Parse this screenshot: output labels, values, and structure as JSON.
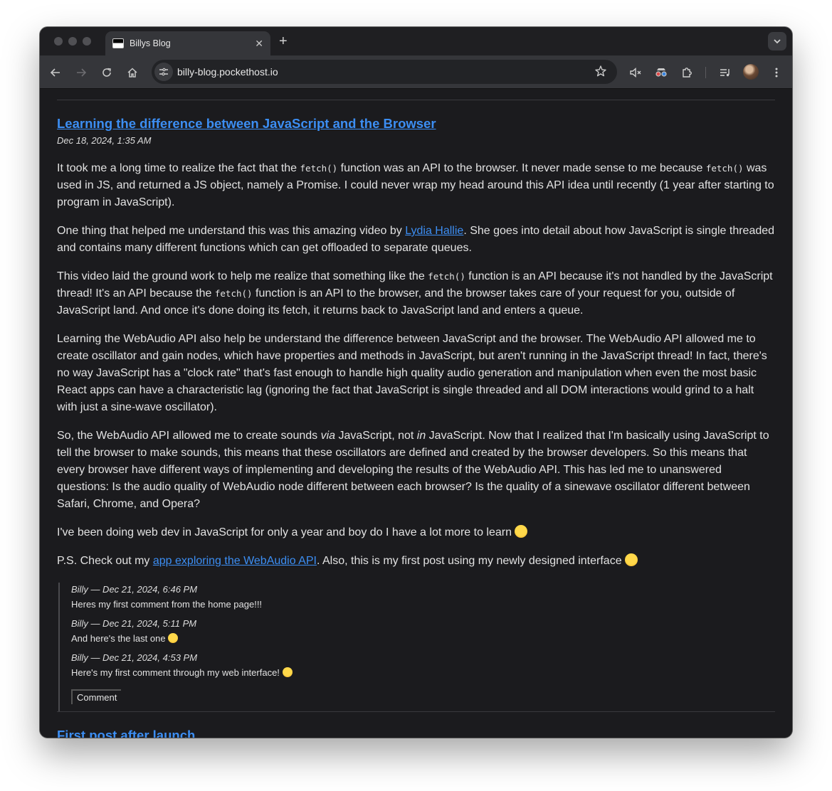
{
  "browser": {
    "tab_title": "Billys Blog",
    "url": "billy-blog.pockethost.io"
  },
  "post": {
    "title": "Learning the difference between JavaScript and the Browser",
    "date": "Dec 18, 2024, 1:35 AM",
    "p1": {
      "a": "It took me a long time to realize the fact that the ",
      "code1": "fetch()",
      "b": " function was an API to the browser. It never made sense to me because ",
      "code2": "fetch()",
      "c": " was used in JS, and returned a JS object, namely a Promise. I could never wrap my head around this API idea until recently (1 year after starting to program in JavaScript)."
    },
    "p2": {
      "a": "One thing that helped me understand this was this amazing video by ",
      "link": "Lydia Hallie",
      "b": ". She goes into detail about how JavaScript is single threaded and contains many different functions which can get offloaded to separate queues."
    },
    "p3": {
      "a": "This video laid the ground work to help me realize that something like the ",
      "code1": "fetch()",
      "b": " function is an API because it's not handled by the JavaScript thread! It's an API because the ",
      "code2": "fetch()",
      "c": " function is an API to the browser, and the browser takes care of your request for you, outside of JavaScript land. And once it's done doing its fetch, it returns back to JavaScript land and enters a queue."
    },
    "p4": "Learning the WebAudio API also help be understand the difference between JavaScript and the browser. The WebAudio API allowed me to create oscillator and gain nodes, which have properties and methods in JavaScript, but aren't running in the JavaScript thread! In fact, there's no way JavaScript has a \"clock rate\" that's fast enough to handle high quality audio generation and manipulation when even the most basic React apps can have a characteristic lag (ignoring the fact that JavaScript is single threaded and all DOM interactions would grind to a halt with just a sine-wave oscillator).",
    "p5": {
      "a": "So, the WebAudio API allowed me to create sounds ",
      "em1": "via",
      "b": " JavaScript, not ",
      "em2": "in",
      "c": " JavaScript. Now that I realized that I'm basically using JavaScript to tell the browser to make sounds, this means that these oscillators are defined and created by the browser developers. So this means that every browser have different ways of implementing and developing the results of the WebAudio API. This has led me to unanswered questions: Is the audio quality of WebAudio node different between each browser? Is the quality of a sinewave oscillator different between Safari, Chrome, and Opera?"
    },
    "p6": "I've been doing web dev in JavaScript for only a year and boy do I have a lot more to learn",
    "p7": {
      "a": "P.S. Check out my ",
      "link": "app exploring the WebAudio API",
      "b": ". Also, this is my first post using my newly designed interface"
    }
  },
  "comments": [
    {
      "meta": "Billy — Dec 21, 2024, 6:46 PM",
      "body": "Heres my first comment from the home page!!!"
    },
    {
      "meta": "Billy — Dec 21, 2024, 5:11 PM",
      "body": "And here's the last one"
    },
    {
      "meta": "Billy — Dec 21, 2024, 4:53 PM",
      "body": "Here's my first comment through my web interface!"
    }
  ],
  "comment_button": "Comment",
  "next_post_title": "First post after launch"
}
